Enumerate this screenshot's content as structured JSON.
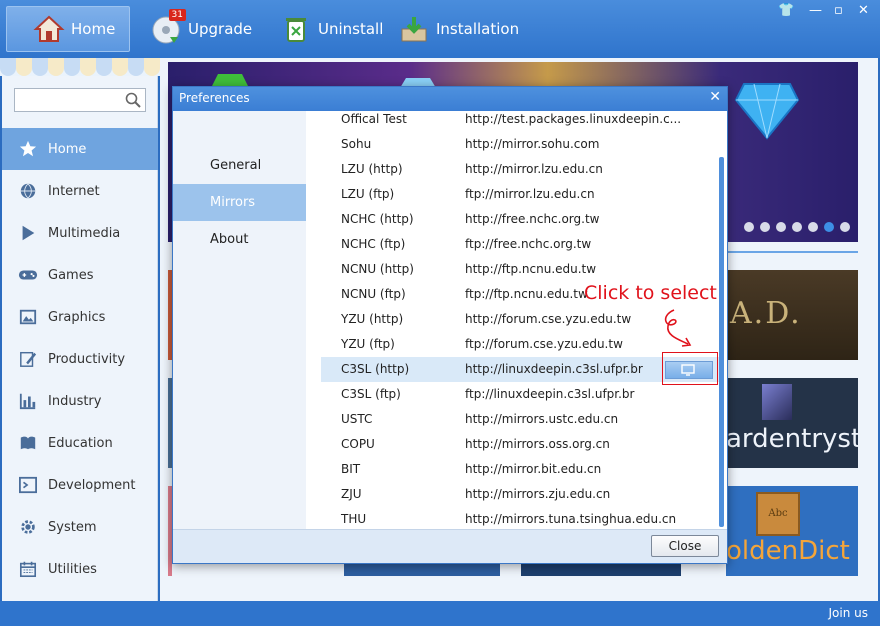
{
  "topbar": {
    "buttons": [
      {
        "label": "Home"
      },
      {
        "label": "Upgrade",
        "badge": "31"
      },
      {
        "label": "Uninstall"
      },
      {
        "label": "Installation"
      }
    ]
  },
  "sidebar": {
    "search_placeholder": "",
    "items": [
      {
        "label": "Home"
      },
      {
        "label": "Internet"
      },
      {
        "label": "Multimedia"
      },
      {
        "label": "Games"
      },
      {
        "label": "Graphics"
      },
      {
        "label": "Productivity"
      },
      {
        "label": "Industry"
      },
      {
        "label": "Education"
      },
      {
        "label": "Development"
      },
      {
        "label": "System"
      },
      {
        "label": "Utilities"
      }
    ]
  },
  "tiles": {
    "ad_text": "A.D.",
    "ardentryst_text": "ardentryst",
    "goldendict_text": "oldenDict",
    "abc_text": "Abc"
  },
  "dialog": {
    "title": "Preferences",
    "close_glyph": "✕",
    "tabs": [
      "General",
      "Mirrors",
      "About"
    ],
    "close_label": "Close",
    "mirrors": [
      {
        "name": "Offical Test",
        "url": "http://test.packages.linuxdeepin.c..."
      },
      {
        "name": "Sohu",
        "url": "http://mirror.sohu.com"
      },
      {
        "name": "LZU (http)",
        "url": "http://mirror.lzu.edu.cn"
      },
      {
        "name": "LZU (ftp)",
        "url": "ftp://mirror.lzu.edu.cn"
      },
      {
        "name": "NCHC (http)",
        "url": "http://free.nchc.org.tw"
      },
      {
        "name": "NCHC (ftp)",
        "url": "ftp://free.nchc.org.tw"
      },
      {
        "name": "NCNU (http)",
        "url": "http://ftp.ncnu.edu.tw"
      },
      {
        "name": "NCNU (ftp)",
        "url": "ftp://ftp.ncnu.edu.tw"
      },
      {
        "name": "YZU (http)",
        "url": "http://forum.cse.yzu.edu.tw"
      },
      {
        "name": "YZU (ftp)",
        "url": "ftp://forum.cse.yzu.edu.tw"
      },
      {
        "name": "C3SL (http)",
        "url": "http://linuxdeepin.c3sl.ufpr.br"
      },
      {
        "name": "C3SL (ftp)",
        "url": "ftp://linuxdeepin.c3sl.ufpr.br"
      },
      {
        "name": "USTC",
        "url": "http://mirrors.ustc.edu.cn"
      },
      {
        "name": "COPU",
        "url": "http://mirrors.oss.org.cn"
      },
      {
        "name": "BIT",
        "url": "http://mirror.bit.edu.cn"
      },
      {
        "name": "ZJU",
        "url": "http://mirrors.zju.edu.cn"
      },
      {
        "name": "THU",
        "url": "http://mirrors.tuna.tsinghua.edu.cn"
      }
    ]
  },
  "annotation": {
    "text": "Click to select"
  },
  "status": {
    "join_label": "Join us"
  },
  "colors": {
    "accent": "#2f74cc",
    "selected": "#6fa4df",
    "annotation": "#e0121b"
  }
}
